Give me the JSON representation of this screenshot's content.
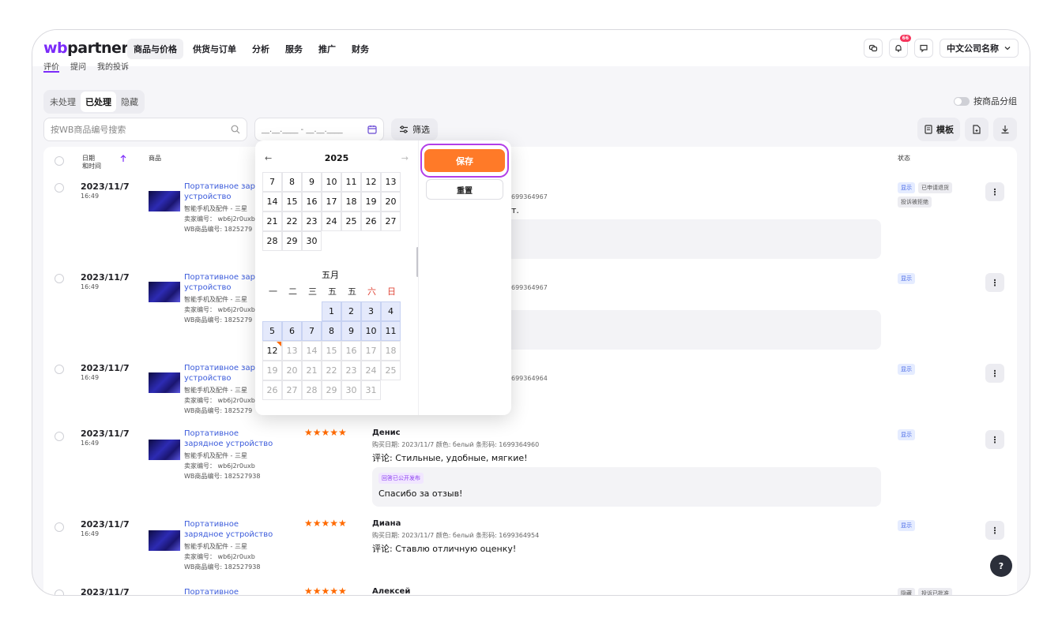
{
  "app": {
    "logo_wb": "wb",
    "logo_rest": "partners",
    "nav": [
      "商品与价格",
      "供货与订单",
      "分析",
      "服务",
      "推广",
      "财务"
    ],
    "notification_count": "66",
    "company": "中文公司名称"
  },
  "subtabs": [
    "评价",
    "提问",
    "我的投诉"
  ],
  "segments": [
    "未处理",
    "已处理",
    "隐藏"
  ],
  "group_toggle_label": "按商品分组",
  "search_placeholder": "按WB商品编号搜索",
  "date_placeholder": "__.__.____ - __.__.____",
  "filter_label": "筛选",
  "template_label": "模板",
  "headers": {
    "date": "日期",
    "datetime": "和时间",
    "product": "商品",
    "status": "状态"
  },
  "picker": {
    "year": "2025",
    "month_label": "五月",
    "prev_arrow": "←",
    "next_arrow": "→",
    "weekdays": [
      "一",
      "二",
      "三",
      "五",
      "五",
      "六",
      "日"
    ],
    "save_label": "保存",
    "reset_label": "重置",
    "prev_month_rows": [
      [
        "7",
        "8",
        "9",
        "10",
        "11",
        "12",
        "13"
      ],
      [
        "14",
        "15",
        "16",
        "17",
        "18",
        "19",
        "20"
      ],
      [
        "21",
        "22",
        "23",
        "24",
        "25",
        "26",
        "27"
      ],
      [
        "28",
        "29",
        "30"
      ]
    ],
    "may_rows": [
      [
        "",
        "",
        "",
        "1",
        "2",
        "3",
        "4"
      ],
      [
        "5",
        "6",
        "7",
        "8",
        "9",
        "10",
        "11"
      ],
      [
        "12",
        "13",
        "14",
        "15",
        "16",
        "17",
        "18"
      ],
      [
        "19",
        "20",
        "21",
        "22",
        "23",
        "24",
        "25"
      ],
      [
        "26",
        "27",
        "28",
        "29",
        "30",
        "31"
      ]
    ]
  },
  "rows": [
    {
      "date": "2023/11/7",
      "time": "16:49",
      "product": "Портативное заря, устройство",
      "category": "智能手机及配件 - 三星",
      "seller": "卖家编号： wb6j2r0uxb",
      "wb_id": "WB商品编号: 1825279",
      "barcode_tail": "699364967",
      "rv_text": "т.",
      "tags": [
        [
          "显示",
          "blue"
        ],
        [
          "已申请退货",
          ""
        ],
        [
          "投诉被拒绝",
          ""
        ]
      ]
    },
    {
      "date": "2023/11/7",
      "time": "16:49",
      "product": "Портативное заря, устройство",
      "category": "智能手机及配件 - 三星",
      "seller": "卖家编号： wb6j2r0uxb",
      "wb_id": "WB商品编号: 1825279",
      "barcode_tail": "699364967",
      "tags": [
        [
          "显示",
          "blue"
        ]
      ]
    },
    {
      "date": "2023/11/7",
      "time": "16:49",
      "product": "Портативное заря, устройство",
      "category": "智能手机及配件 - 三星",
      "seller": "卖家编号： wb6j2r0uxb",
      "wb_id": "WB商品编号: 1825279",
      "barcode_tail": "699364964",
      "tags": [
        [
          "显示",
          "blue"
        ]
      ]
    },
    {
      "date": "2023/11/7",
      "time": "16:49",
      "product": "Портативное зарядное устройство",
      "category": "智能手机及配件 - 三星",
      "seller": "卖家编号： wb6j2r0uxb",
      "wb_id": "WB商品编号: 182527938",
      "stars": "★★★★★",
      "reviewer": "Денис",
      "meta": "购买日期: 2023/11/7   颜色: белый   条形码: 1699364960",
      "review": "评论: Стильные, удобные, мягкие!",
      "reply_tag": "回答已公开发布",
      "reply": "Спасибо за отзыв!",
      "tags": [
        [
          "显示",
          "blue"
        ]
      ]
    },
    {
      "date": "2023/11/7",
      "time": "16:49",
      "product": "Портативное зарядное устройство",
      "category": "智能手机及配件 - 三星",
      "seller": "卖家编号： wb6j2r0uxb",
      "wb_id": "WB商品编号: 182527938",
      "stars": "★★★★★",
      "reviewer": "Диана",
      "meta": "购买日期: 2023/11/7   颜色: белый   条形码: 1699364954",
      "review": "评论: Ставлю отличную оценку!",
      "tags": [
        [
          "显示",
          "blue"
        ]
      ]
    },
    {
      "date": "2023/11/7",
      "product": "Портативное зарядное",
      "stars": "★★★★★",
      "reviewer": "Алексей",
      "tags": [
        [
          "隐藏",
          ""
        ],
        [
          "投诉已批准",
          ""
        ]
      ]
    }
  ]
}
